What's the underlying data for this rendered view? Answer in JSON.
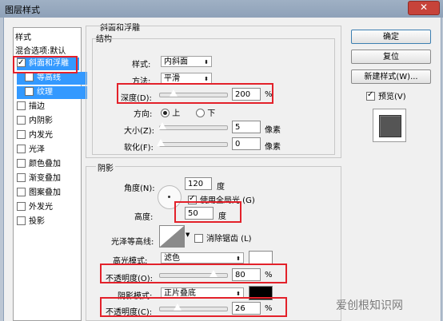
{
  "window": {
    "title": "图层样式",
    "close_glyph": "✕"
  },
  "styles_panel": {
    "heading": "样式",
    "blending": "混合选项:默认",
    "items": [
      {
        "label": "斜面和浮雕",
        "checked": true,
        "selected": true
      },
      {
        "label": "等高线",
        "checked": false,
        "selected": true
      },
      {
        "label": "纹理",
        "checked": false,
        "selected": true
      },
      {
        "label": "描边",
        "checked": false
      },
      {
        "label": "内阴影",
        "checked": false
      },
      {
        "label": "内发光",
        "checked": false
      },
      {
        "label": "光泽",
        "checked": false
      },
      {
        "label": "颜色叠加",
        "checked": false
      },
      {
        "label": "渐变叠加",
        "checked": false
      },
      {
        "label": "图案叠加",
        "checked": false
      },
      {
        "label": "外发光",
        "checked": false
      },
      {
        "label": "投影",
        "checked": false
      }
    ]
  },
  "bevel": {
    "section_title": "斜面和浮雕",
    "structure_title": "结构",
    "style_label": "样式:",
    "style_value": "内斜面",
    "method_label": "方法:",
    "method_value": "平滑",
    "depth_label": "深度(D):",
    "depth_value": "200",
    "depth_level": 0.2,
    "percent": "%",
    "direction_label": "方向:",
    "direction_up": "上",
    "direction_down": "下",
    "size_label": "大小(Z):",
    "size_value": "5",
    "size_unit": "像素",
    "soften_label": "软化(F):",
    "soften_value": "0",
    "soften_unit": "像素"
  },
  "shading": {
    "title": "阴影",
    "angle_label": "角度(N):",
    "angle_value": "120",
    "angle_unit": "度",
    "global_light_label": "使用全局光 (G)",
    "global_light_checked": true,
    "altitude_label": "高度:",
    "altitude_value": "50",
    "altitude_unit": "度",
    "gloss_contour_label": "光泽等高线:",
    "antialias_label": "消除锯齿 (L)",
    "highlight_mode_label": "高光模式:",
    "highlight_mode_value": "滤色",
    "highlight_opacity_label": "不透明度(O):",
    "highlight_opacity_value": "80",
    "highlight_opacity_level": 0.8,
    "shadow_mode_label": "阴影模式:",
    "shadow_mode_value": "正片叠底",
    "shadow_opacity_label": "不透明度(C):",
    "shadow_opacity_value": "26",
    "shadow_opacity_level": 0.26,
    "highlight_color": "#ffffff",
    "shadow_color": "#000000"
  },
  "buttons": {
    "ok": "确定",
    "reset": "复位",
    "new_style": "新建样式(W)...",
    "preview_label": "预览(V)"
  },
  "watermark": "爱创根知识网"
}
